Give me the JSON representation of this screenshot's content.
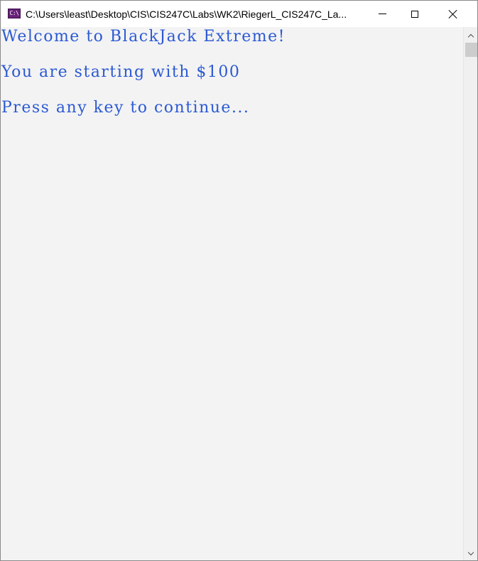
{
  "window": {
    "title": "C:\\Users\\least\\Desktop\\CIS\\CIS247C\\Labs\\WK2\\RiegerL_CIS247C_La...",
    "icon_text": "C:\\",
    "icon": "console-app-icon",
    "controls": {
      "minimize_icon": "minimize-icon",
      "maximize_icon": "maximize-icon",
      "close_icon": "close-icon"
    }
  },
  "console": {
    "text_color": "#2b59d3",
    "background_color": "#f3f3f3",
    "lines": [
      "Welcome to BlackJack Extreme!",
      "You are starting with $100",
      "Press any key to continue..."
    ]
  },
  "scrollbar": {
    "up_icon": "chevron-up-icon",
    "down_icon": "chevron-down-icon"
  }
}
